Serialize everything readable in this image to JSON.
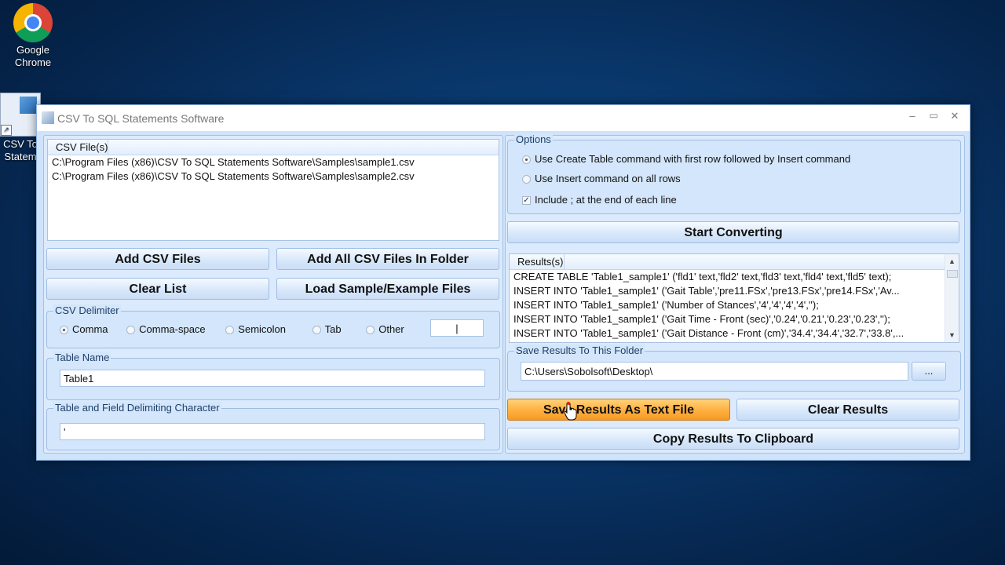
{
  "desktop": {
    "icons": [
      {
        "label_line1": "Google",
        "label_line2": "Chrome"
      },
      {
        "label_line1": "CSV To",
        "label_line2": "Statem"
      }
    ]
  },
  "window": {
    "title": "CSV To SQL Statements Software",
    "controls": {
      "minimize": "–",
      "maximize": "▭",
      "close": "✕"
    }
  },
  "csv_files": {
    "header": "CSV File(s)",
    "items": [
      "C:\\Program Files (x86)\\CSV To SQL Statements Software\\Samples\\sample1.csv",
      "C:\\Program Files (x86)\\CSV To SQL Statements Software\\Samples\\sample2.csv"
    ]
  },
  "buttons": {
    "add_csv": "Add CSV Files",
    "add_all": "Add All CSV Files In Folder",
    "clear_list": "Clear List",
    "load_sample": "Load Sample/Example Files",
    "start": "Start Converting",
    "save_results": "Save Results As Text File",
    "clear_results": "Clear Results",
    "copy_results": "Copy Results To Clipboard",
    "browse": "..."
  },
  "delimiter": {
    "legend": "CSV Delimiter",
    "options": [
      "Comma",
      "Comma-space",
      "Semicolon",
      "Tab",
      "Other"
    ],
    "selected": "Comma",
    "other_value": "|"
  },
  "table_name": {
    "legend": "Table Name",
    "value": "Table1"
  },
  "field_delim": {
    "legend": "Table and Field Delimiting Character",
    "value": "'"
  },
  "options": {
    "legend": "Options",
    "radio1": "Use Create Table command with first row followed by Insert command",
    "radio2": "Use Insert command on all rows",
    "check1": "Include ; at the end of each line",
    "check_mark": "✓"
  },
  "results": {
    "header": "Results(s)",
    "lines": [
      "CREATE TABLE 'Table1_sample1' ('fld1' text,'fld2' text,'fld3' text,'fld4' text,'fld5' text);",
      "INSERT INTO 'Table1_sample1' ('Gait Table','pre11.FSx','pre13.FSx','pre14.FSx','Av...",
      "INSERT INTO 'Table1_sample1' ('Number of Stances','4','4','4','4','');",
      "INSERT INTO 'Table1_sample1' ('Gait Time - Front (sec)','0.24','0.21','0.23','0.23','');",
      "INSERT INTO 'Table1_sample1' ('Gait Distance - Front (cm)','34.4','34.4','32.7','33.8',..."
    ],
    "scroll_up": "▲",
    "scroll_down": "▼"
  },
  "save_folder": {
    "legend": "Save Results To This Folder",
    "path": "C:\\Users\\Sobolsoft\\Desktop\\"
  }
}
